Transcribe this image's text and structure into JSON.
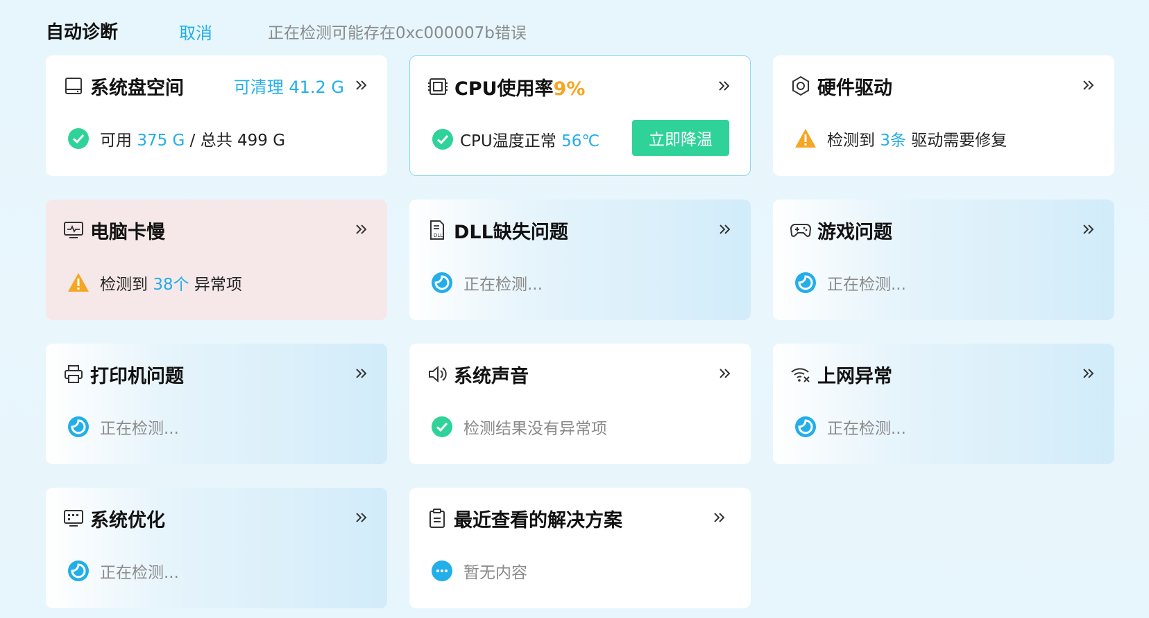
{
  "header": {
    "title": "自动诊断",
    "cancel_label": "取消",
    "status_text": "正在检测可能存在0xc000007b错误"
  },
  "colors": {
    "accent": "#22aee8",
    "ok": "#2fd39a",
    "warn": "#f5a623",
    "scan": "#22aee8"
  },
  "cards": [
    {
      "id": "disk",
      "icon": "disk-icon",
      "title": "系统盘空间",
      "extra": "可清理 41.2 G",
      "state": "ok",
      "body": {
        "prefix": "可用",
        "highlight": "375 G",
        "suffix": "/ 总共 499 G"
      }
    },
    {
      "id": "cpu",
      "icon": "cpu-chip-icon",
      "title": "CPU使用率",
      "title_highlight": "9%",
      "state": "ok",
      "body": {
        "prefix": "CPU温度正常",
        "highlight": "56℃",
        "suffix": ""
      },
      "button": "立即降温"
    },
    {
      "id": "driver",
      "icon": "gear-icon",
      "title": "硬件驱动",
      "state": "warn",
      "body": {
        "prefix": "检测到",
        "highlight": "3条",
        "suffix": "驱动需要修复"
      }
    },
    {
      "id": "slow",
      "icon": "monitor-pulse-icon",
      "title": "电脑卡慢",
      "state": "warn",
      "body": {
        "prefix": "检测到",
        "highlight": "38个",
        "suffix": "异常项"
      }
    },
    {
      "id": "dll",
      "icon": "dll-file-icon",
      "title": "DLL缺失问题",
      "state": "scan",
      "body": {
        "prefix": "正在检测...",
        "highlight": "",
        "suffix": ""
      }
    },
    {
      "id": "game",
      "icon": "gamepad-icon",
      "title": "游戏问题",
      "state": "scan",
      "body": {
        "prefix": "正在检测...",
        "highlight": "",
        "suffix": ""
      }
    },
    {
      "id": "printer",
      "icon": "printer-icon",
      "title": "打印机问题",
      "state": "scan",
      "body": {
        "prefix": "正在检测...",
        "highlight": "",
        "suffix": ""
      }
    },
    {
      "id": "sound",
      "icon": "speaker-icon",
      "title": "系统声音",
      "state": "ok",
      "body": {
        "prefix": "检测结果没有异常项",
        "highlight": "",
        "suffix": ""
      }
    },
    {
      "id": "network",
      "icon": "wifi-error-icon",
      "title": "上网异常",
      "state": "scan",
      "body": {
        "prefix": "正在检测...",
        "highlight": "",
        "suffix": ""
      }
    },
    {
      "id": "optimize",
      "icon": "dashboard-icon",
      "title": "系统优化",
      "state": "scan",
      "body": {
        "prefix": "正在检测...",
        "highlight": "",
        "suffix": ""
      }
    },
    {
      "id": "recent",
      "icon": "clipboard-icon",
      "title": "最近查看的解决方案",
      "state": "more",
      "body": {
        "prefix": "暂无内容",
        "highlight": "",
        "suffix": ""
      }
    }
  ]
}
